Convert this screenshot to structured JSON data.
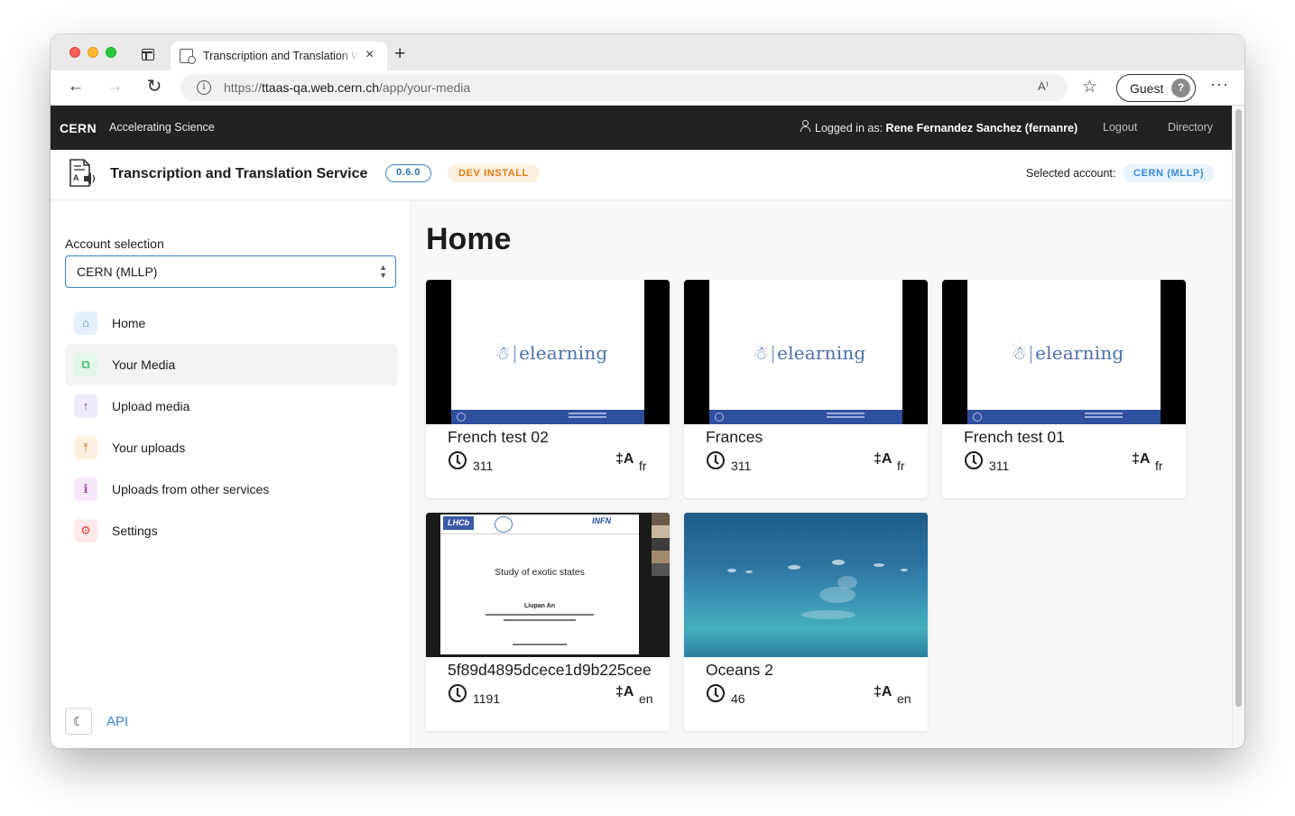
{
  "browser": {
    "tab_title": "Transcription and Translation Web",
    "url_prefix": "https://",
    "url_host": "ttaas-qa.web.cern.ch",
    "url_path": "/app/your-media",
    "guest_label": "Guest",
    "read_aloud_glyph": "A⁾",
    "more_glyph": "···",
    "new_tab_glyph": "+",
    "close_glyph": "×",
    "back_glyph": "←",
    "forward_glyph": "→",
    "reload_glyph": "↻",
    "favorites_glyph": "☆",
    "info_glyph": "i",
    "avatar_glyph": "?"
  },
  "cern_bar": {
    "logo": "CERN",
    "tagline": "Accelerating Science",
    "logged_in_prefix": "Logged in as:",
    "user": "Rene Fernandez Sanchez (fernanre)",
    "logout": "Logout",
    "directory": "Directory"
  },
  "app_header": {
    "title": "Transcription and Translation Service",
    "version": "0.6.0",
    "install_badge": "DEV INSTALL",
    "selected_account_label": "Selected account:",
    "selected_account": "CERN (MLLP)"
  },
  "sidebar": {
    "account_label": "Account selection",
    "account_value": "CERN (MLLP)",
    "items": [
      {
        "label": "Home",
        "icon": "home-icon",
        "glyph": "⌂",
        "color": "#3a84c9",
        "bg": "#e6f1fb"
      },
      {
        "label": "Your Media",
        "icon": "media-icon",
        "glyph": "⧉",
        "color": "#17a34a",
        "bg": "#e3f6ea"
      },
      {
        "label": "Upload media",
        "icon": "upload-icon",
        "glyph": "↑",
        "color": "#6d4ad1",
        "bg": "#eeeaf9"
      },
      {
        "label": "Your uploads",
        "icon": "uploads-file-icon",
        "glyph": "⤒",
        "color": "#e07a14",
        "bg": "#fdf0e1"
      },
      {
        "label": "Uploads from other services",
        "icon": "other-services-icon",
        "glyph": "ℹ",
        "color": "#b443c4",
        "bg": "#f7e8f9"
      },
      {
        "label": "Settings",
        "icon": "settings-icon",
        "glyph": "⚙",
        "color": "#e0454b",
        "bg": "#fdeaea"
      }
    ],
    "active_index": 1,
    "theme_glyph": "☾",
    "api_label": "API"
  },
  "main": {
    "title": "Home",
    "cards": [
      {
        "title": "French test 02",
        "duration": "311",
        "lang": "fr",
        "thumb": "elearning"
      },
      {
        "title": "Frances",
        "duration": "311",
        "lang": "fr",
        "thumb": "elearning"
      },
      {
        "title": "French test 01",
        "duration": "311",
        "lang": "fr",
        "thumb": "elearning"
      },
      {
        "title": "5f89d4895dcece1d9b225cee",
        "duration": "1191",
        "lang": "en",
        "thumb": "exotic"
      },
      {
        "title": "Oceans 2",
        "duration": "46",
        "lang": "en",
        "thumb": "ocean"
      }
    ],
    "lang_glyph": "‡A",
    "slide_logo_text": "elearning",
    "slide_logo_mark": "☃",
    "exotic_slide": {
      "title": "Study of exotic states",
      "author": "Liupan An",
      "lhcb": "LHCb",
      "infn": "INFN"
    }
  }
}
